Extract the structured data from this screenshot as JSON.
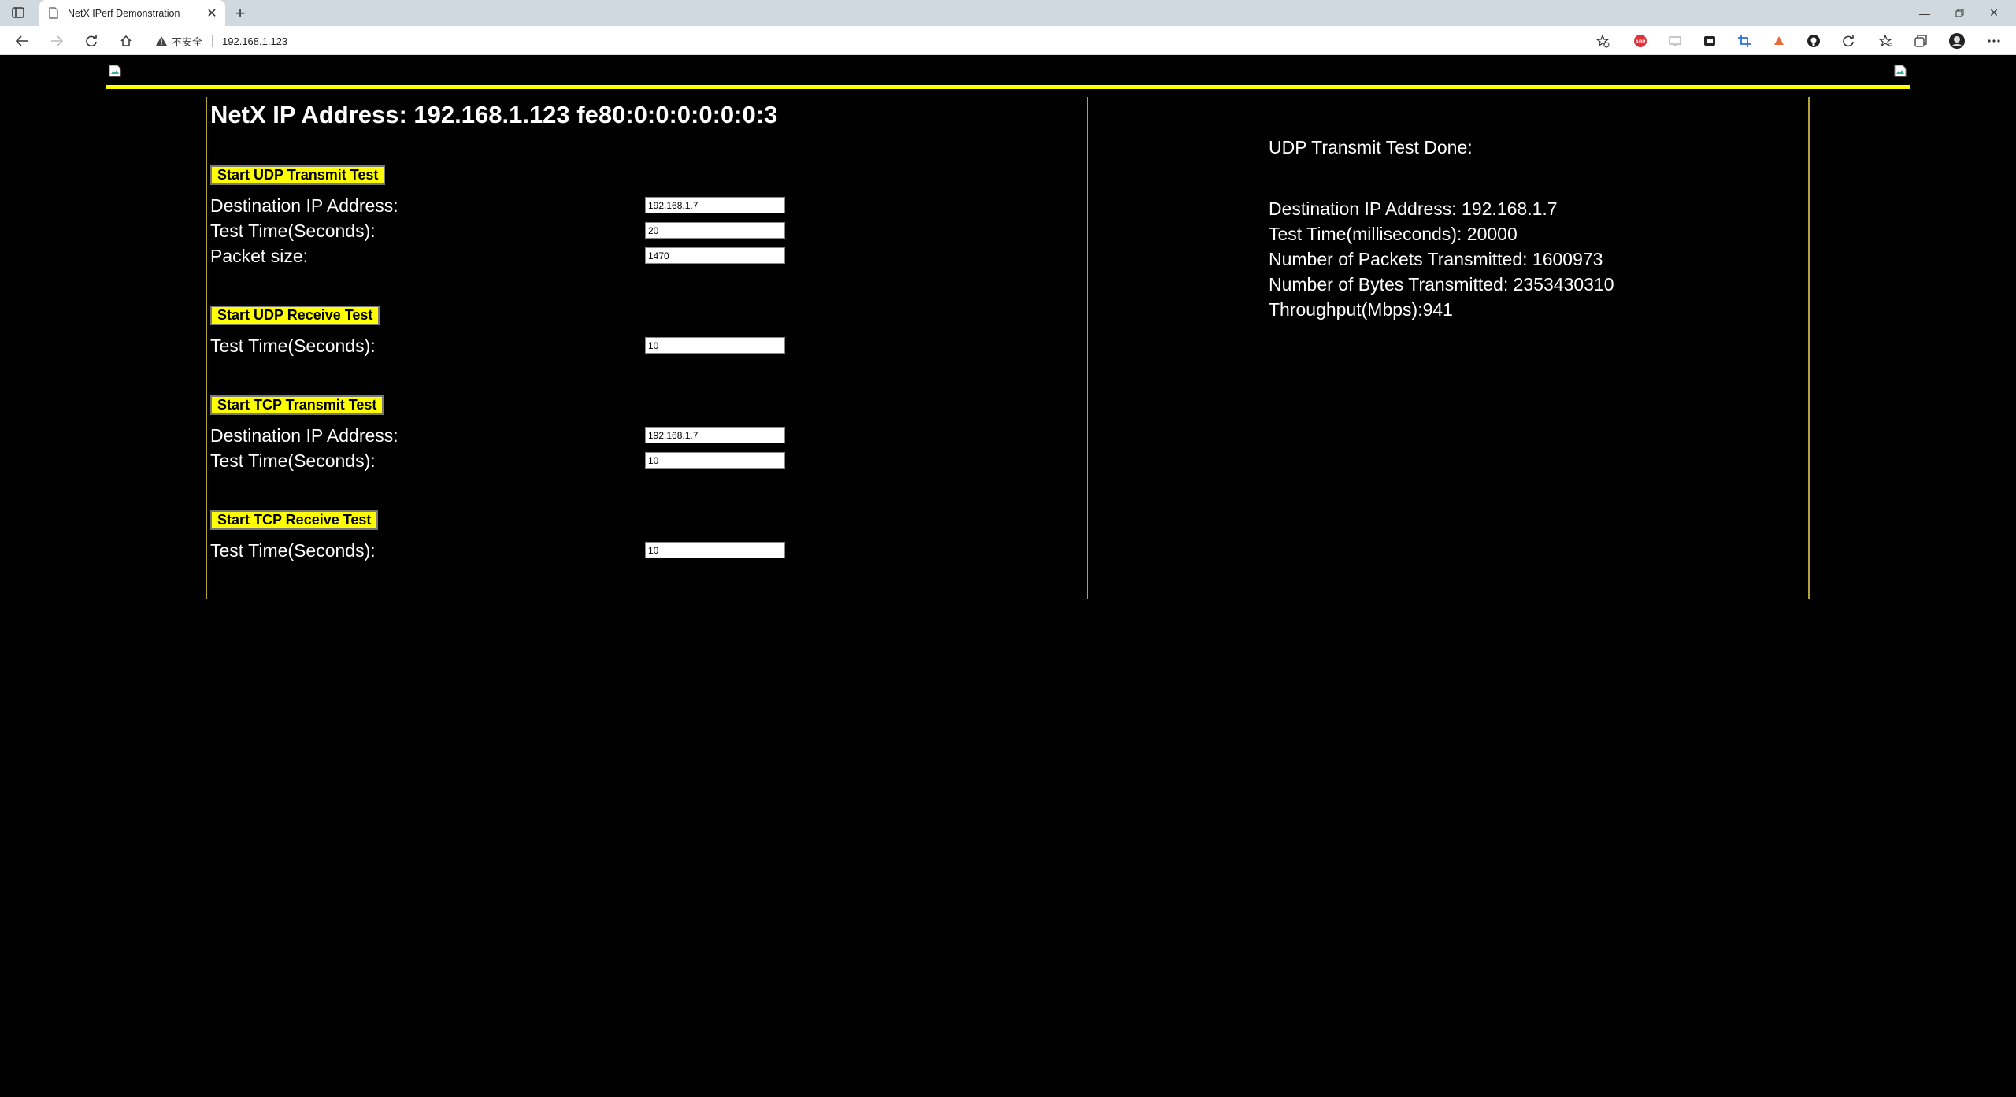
{
  "browser": {
    "tab_title": "NetX IPerf Demonstration",
    "insecure_label": "不安全",
    "url": "192.168.1.123"
  },
  "page": {
    "ip_heading": "NetX IP Address: 192.168.1.123 fe80:0:0:0:0:0:0:3",
    "udp_tx": {
      "button": "Start UDP Transmit Test",
      "dest_label": "Destination IP Address:",
      "dest_value": "192.168.1.7",
      "time_label": "Test Time(Seconds):",
      "time_value": "20",
      "size_label": "Packet size:",
      "size_value": "1470"
    },
    "udp_rx": {
      "button": "Start UDP Receive Test",
      "time_label": "Test Time(Seconds):",
      "time_value": "10"
    },
    "tcp_tx": {
      "button": "Start TCP Transmit Test",
      "dest_label": "Destination IP Address:",
      "dest_value": "192.168.1.7",
      "time_label": "Test Time(Seconds):",
      "time_value": "10"
    },
    "tcp_rx": {
      "button": "Start TCP Receive Test",
      "time_label": "Test Time(Seconds):",
      "time_value": "10"
    },
    "results": {
      "status": "UDP Transmit Test Done:",
      "dest": "Destination IP Address: 192.168.1.7",
      "time": "Test Time(milliseconds): 20000",
      "packets": "Number of Packets Transmitted: 1600973",
      "bytes": "Number of Bytes Transmitted: 2353430310",
      "throughput": "Throughput(Mbps):941"
    }
  }
}
